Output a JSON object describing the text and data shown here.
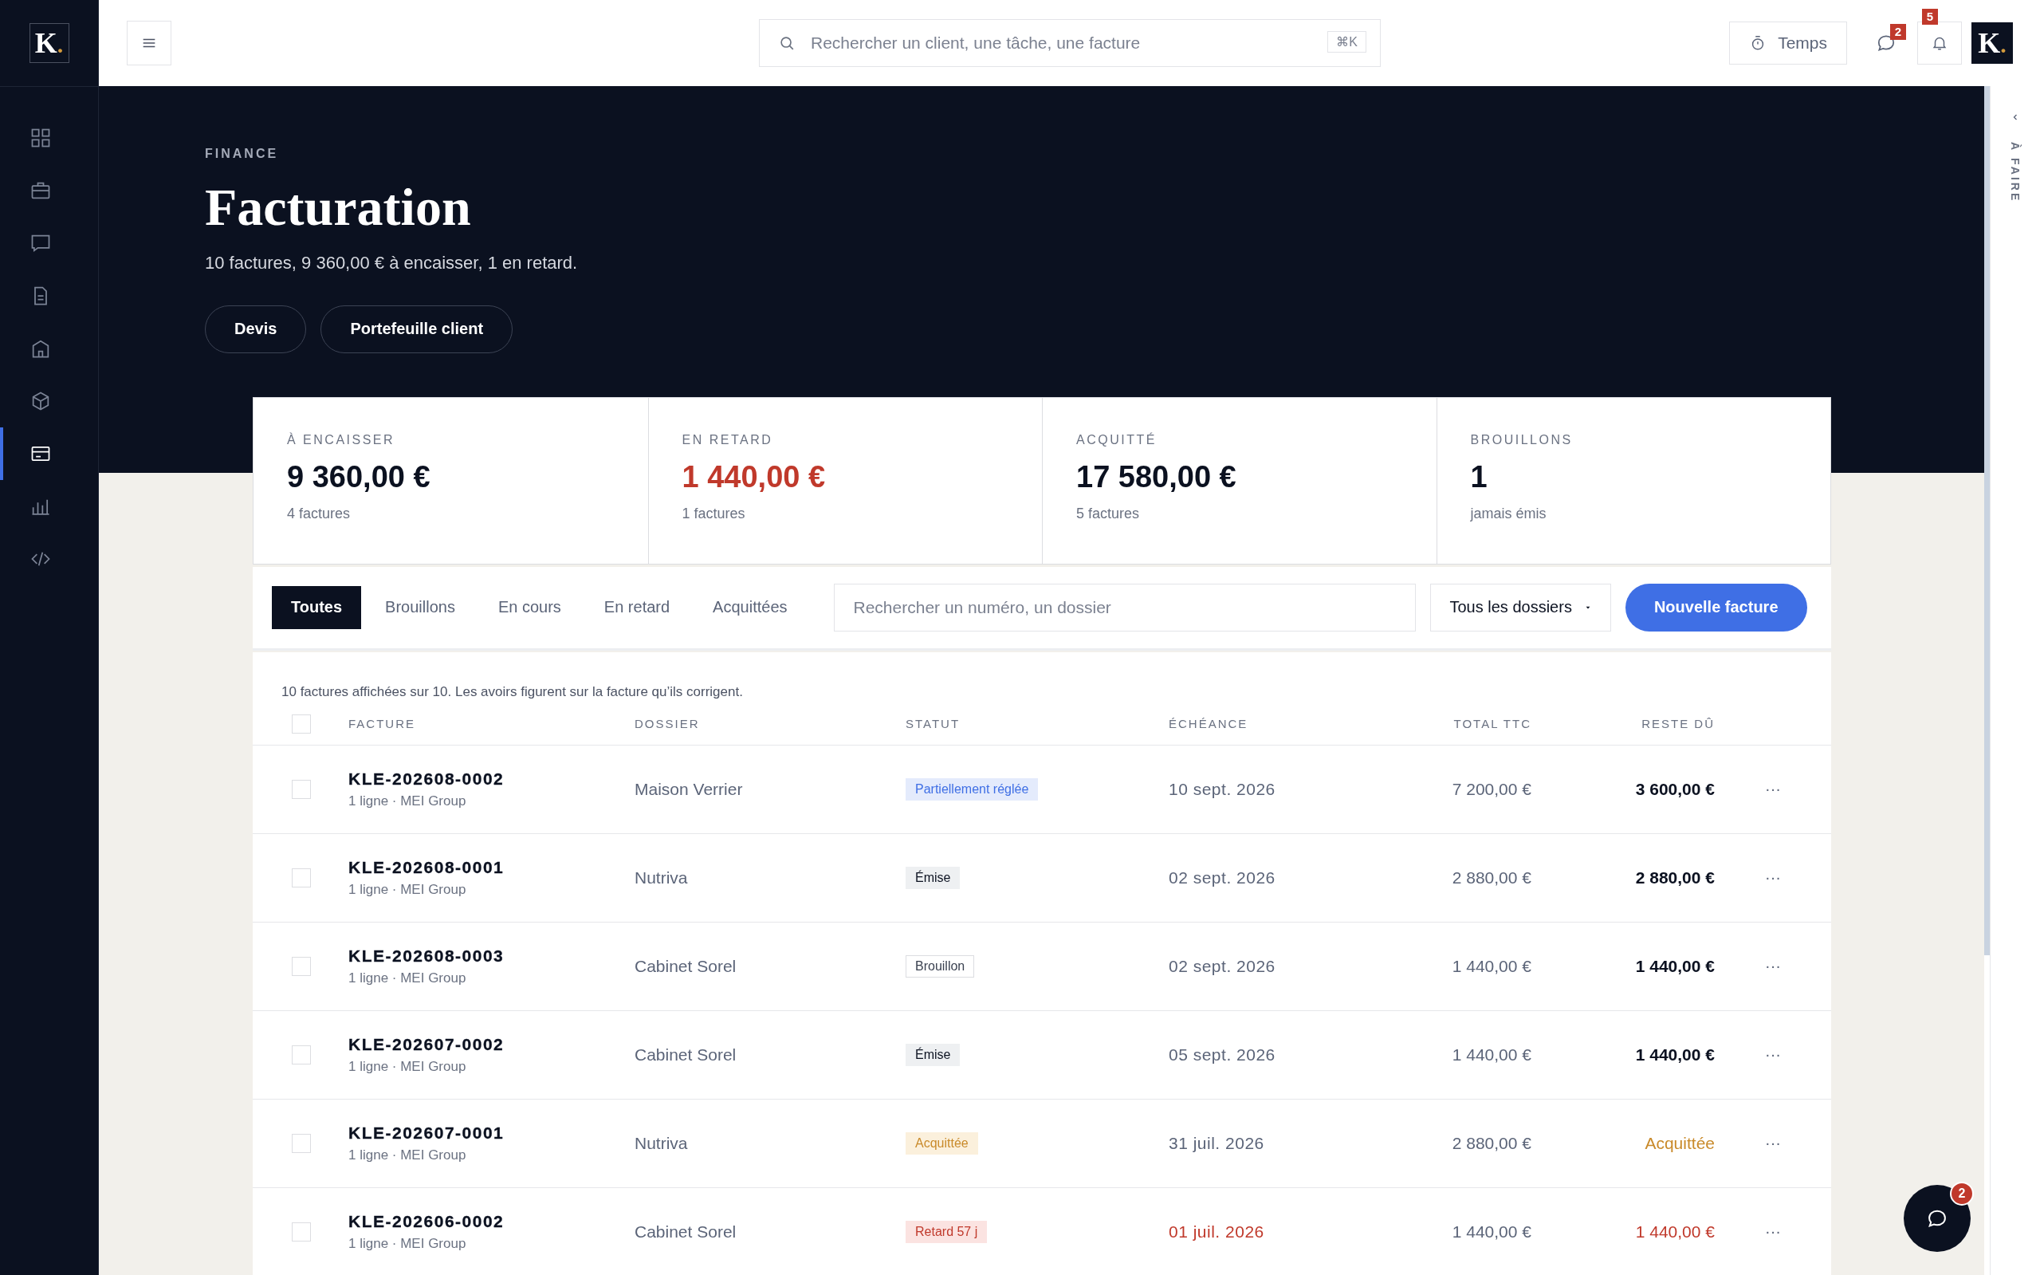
{
  "sidebar": {
    "logo": {
      "letter": "K",
      "dot": "."
    },
    "items": [
      {
        "kind": "grid",
        "selected": false
      },
      {
        "kind": "briefcase",
        "selected": false
      },
      {
        "kind": "chat",
        "selected": false
      },
      {
        "kind": "document",
        "selected": false
      },
      {
        "kind": "building",
        "selected": false
      },
      {
        "kind": "cube",
        "selected": false
      },
      {
        "kind": "card",
        "selected": true
      },
      {
        "kind": "chart",
        "selected": false
      },
      {
        "kind": "code",
        "selected": false
      }
    ]
  },
  "topbar": {
    "search": {
      "placeholder": "Rechercher un client, une tâche, une facture",
      "shortcut": "⌘K"
    },
    "time_button": "Temps",
    "messages": {
      "badge": "2"
    },
    "notifications": {
      "badge": "5"
    },
    "avatar": {
      "letter": "K",
      "dot": "."
    }
  },
  "right_panel": {
    "title": "À FAIRE"
  },
  "hero": {
    "eyebrow": "FINANCE",
    "title": "Facturation",
    "summary": "10 factures, 9 360,00 € à encaisser, 1 en retard.",
    "buttons": [
      "Devis",
      "Portefeuille client"
    ]
  },
  "stats": [
    {
      "label": "À ENCAISSER",
      "value": "9 360,00 €",
      "note": "4 factures",
      "kind": "neutral"
    },
    {
      "label": "EN RETARD",
      "value": "1 440,00 €",
      "note": "1 factures",
      "kind": "alert"
    },
    {
      "label": "ACQUITTÉ",
      "value": "17 580,00 €",
      "note": "5 factures",
      "kind": "neutral"
    },
    {
      "label": "BROUILLONS",
      "value": "1",
      "note": "jamais émis",
      "kind": "neutral"
    }
  ],
  "tabs": [
    {
      "label": "Toutes",
      "selected": true
    },
    {
      "label": "Brouillons",
      "selected": false
    },
    {
      "label": "En cours",
      "selected": false
    },
    {
      "label": "En retard",
      "selected": false
    },
    {
      "label": "Acquittées",
      "selected": false
    }
  ],
  "filters": {
    "search": {
      "placeholder": "Rechercher un numéro, un dossier"
    },
    "folder": "Tous les dossiers",
    "new_button": "Nouvelle facture"
  },
  "table": {
    "caption": "10 factures affichées sur 10. Les avoirs figurent sur la facture qu’ils corrigent.",
    "all_checked": false,
    "columns": [
      "FACTURE",
      "DOSSIER",
      "STATUT",
      "ÉCHÉANCE",
      "TOTAL TTC",
      "RESTE DÛ"
    ],
    "rows": [
      {
        "checked": false,
        "number": "KLE-202608-0002",
        "meta": "1 ligne · MEI Group",
        "folder": "Maison Verrier",
        "status": {
          "label": "Partiellement réglée",
          "kind": "partial"
        },
        "due": "10 sept. 2026",
        "total": "7 200,00 €",
        "remaining": "3 600,00 €",
        "actions": "···"
      },
      {
        "checked": false,
        "number": "KLE-202608-0001",
        "meta": "1 ligne · MEI Group",
        "folder": "Nutriva",
        "status": {
          "label": "Émise",
          "kind": "issued"
        },
        "due": "02 sept. 2026",
        "total": "2 880,00 €",
        "remaining": "2 880,00 €",
        "actions": "···"
      },
      {
        "checked": false,
        "number": "KLE-202608-0003",
        "meta": "1 ligne · MEI Group",
        "folder": "Cabinet Sorel",
        "status": {
          "label": "Brouillon",
          "kind": "draft"
        },
        "due": "02 sept. 2026",
        "total": "1 440,00 €",
        "remaining": "1 440,00 €",
        "actions": "···"
      },
      {
        "checked": false,
        "number": "KLE-202607-0002",
        "meta": "1 ligne · MEI Group",
        "folder": "Cabinet Sorel",
        "status": {
          "label": "Émise",
          "kind": "issued"
        },
        "due": "05 sept. 2026",
        "total": "1 440,00 €",
        "remaining": "1 440,00 €",
        "actions": "···"
      },
      {
        "checked": false,
        "number": "KLE-202607-0001",
        "meta": "1 ligne · MEI Group",
        "folder": "Nutriva",
        "status": {
          "label": "Acquittée",
          "kind": "paid"
        },
        "due": "31 juil. 2026",
        "total": "2 880,00 €",
        "remaining": "Acquittée",
        "actions": "···"
      },
      {
        "checked": false,
        "number": "KLE-202606-0002",
        "meta": "1 ligne · MEI Group",
        "folder": "Cabinet Sorel",
        "status": {
          "label": "Retard 57 j",
          "kind": "late"
        },
        "due": "01 juil. 2026",
        "total": "1 440,00 €",
        "remaining": "1 440,00 €",
        "actions": "···"
      }
    ]
  },
  "chat": {
    "badge": "2"
  }
}
